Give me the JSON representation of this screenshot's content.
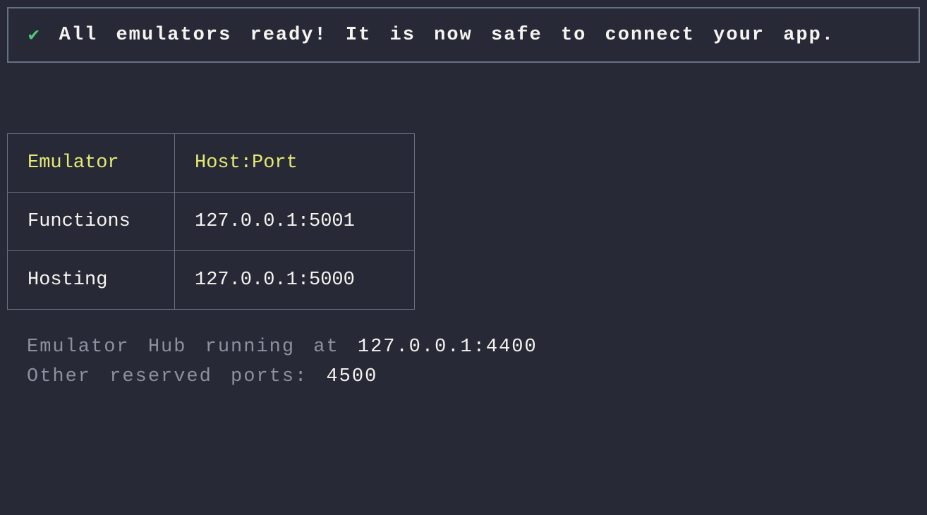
{
  "status": {
    "check": "✔",
    "message": "All emulators ready! It is now safe to connect your app."
  },
  "table": {
    "headers": {
      "emulator": "Emulator",
      "hostport": "Host:Port"
    },
    "rows": [
      {
        "name": "Functions",
        "hostport": "127.0.0.1:5001"
      },
      {
        "name": "Hosting",
        "hostport": "127.0.0.1:5000"
      }
    ]
  },
  "info": {
    "hub_label": "Emulator Hub running at ",
    "hub_value": "127.0.0.1:4400",
    "reserved_label": "Other reserved ports: ",
    "reserved_value": "4500"
  }
}
